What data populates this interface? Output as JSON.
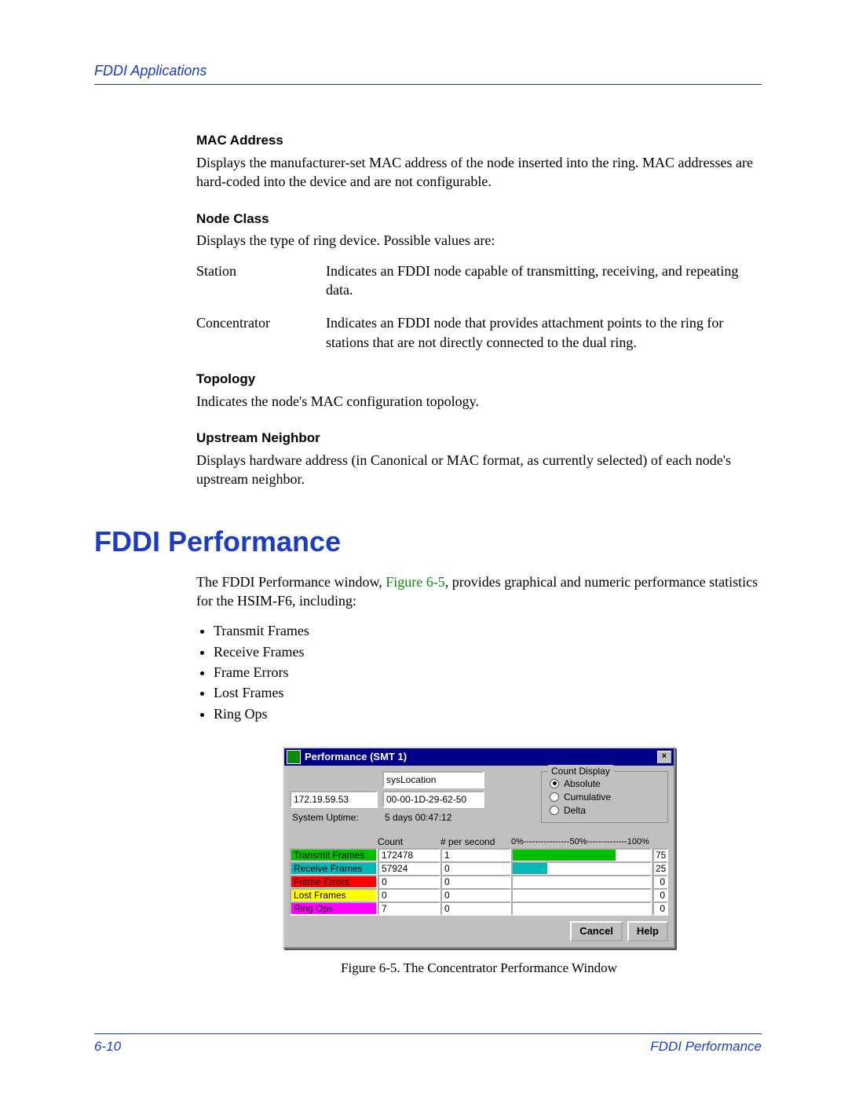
{
  "header": {
    "section": "FDDI Applications"
  },
  "fields": {
    "mac": {
      "heading": "MAC Address",
      "text": "Displays the manufacturer-set MAC address of the node inserted into the ring. MAC addresses are hard-coded into the device and are not configurable."
    },
    "nodeClass": {
      "heading": "Node Class",
      "text": "Displays the type of ring device. Possible values are:",
      "defs": [
        {
          "term": "Station",
          "desc": "Indicates an FDDI node capable of transmitting, receiving, and repeating data."
        },
        {
          "term": "Concentrator",
          "desc": "Indicates an FDDI node that provides attachment points to the ring for stations that are not directly connected to the dual ring."
        }
      ]
    },
    "topology": {
      "heading": "Topology",
      "text": "Indicates the node's MAC configuration topology."
    },
    "upstream": {
      "heading": "Upstream Neighbor",
      "text": "Displays hardware address (in Canonical or MAC format, as currently selected) of each node's upstream neighbor."
    }
  },
  "h1": "FDDI Performance",
  "intro": {
    "pre": "The FDDI Performance window, ",
    "figref": "Figure 6-5",
    "post": ", provides graphical and numeric performance statistics for the HSIM-F6, including:"
  },
  "bullets": [
    "Transmit Frames",
    "Receive Frames",
    "Frame Errors",
    "Lost Frames",
    "Ring Ops"
  ],
  "window": {
    "title": "Performance (SMT 1)",
    "close": "×",
    "sysLocationLabel": "sysLocation",
    "ip": "172.19.59.53",
    "mac": "00-00-1D-29-62-50",
    "uptimeLabel": "System Uptime:",
    "uptime": "5 days 00:47:12",
    "group": {
      "legend": "Count Display",
      "options": [
        "Absolute",
        "Cumulative",
        "Delta"
      ],
      "selected": 0
    },
    "cols": {
      "count": "Count",
      "pps": "# per second",
      "scale": "0%----------------50%--------------100%"
    },
    "rows": [
      {
        "name": "Transmit Frames",
        "bg": "#00c000",
        "count": "172478",
        "pps": "1",
        "barColor": "#00c000",
        "barPct": 75,
        "val": "75"
      },
      {
        "name": "Receive Frames",
        "bg": "#00b8b8",
        "count": "57924",
        "pps": "0",
        "barColor": "#00b8b8",
        "barPct": 25,
        "val": "25"
      },
      {
        "name": "Frame Errors",
        "bg": "#ff0000",
        "count": "0",
        "pps": "0",
        "barColor": "#ff0000",
        "barPct": 0,
        "val": "0"
      },
      {
        "name": "Lost Frames",
        "bg": "#ffff00",
        "count": "0",
        "pps": "0",
        "barColor": "#ffff00",
        "barPct": 0,
        "val": "0"
      },
      {
        "name": "Ring Ops",
        "bg": "#ff00ff",
        "count": "7",
        "pps": "0",
        "barColor": "#ff00ff",
        "barPct": 0,
        "val": "0"
      }
    ],
    "buttons": {
      "cancel": "Cancel",
      "help": "Help"
    }
  },
  "caption": "Figure 6-5. The Concentrator Performance Window",
  "footer": {
    "pageno": "6-10",
    "section": "FDDI Performance"
  }
}
